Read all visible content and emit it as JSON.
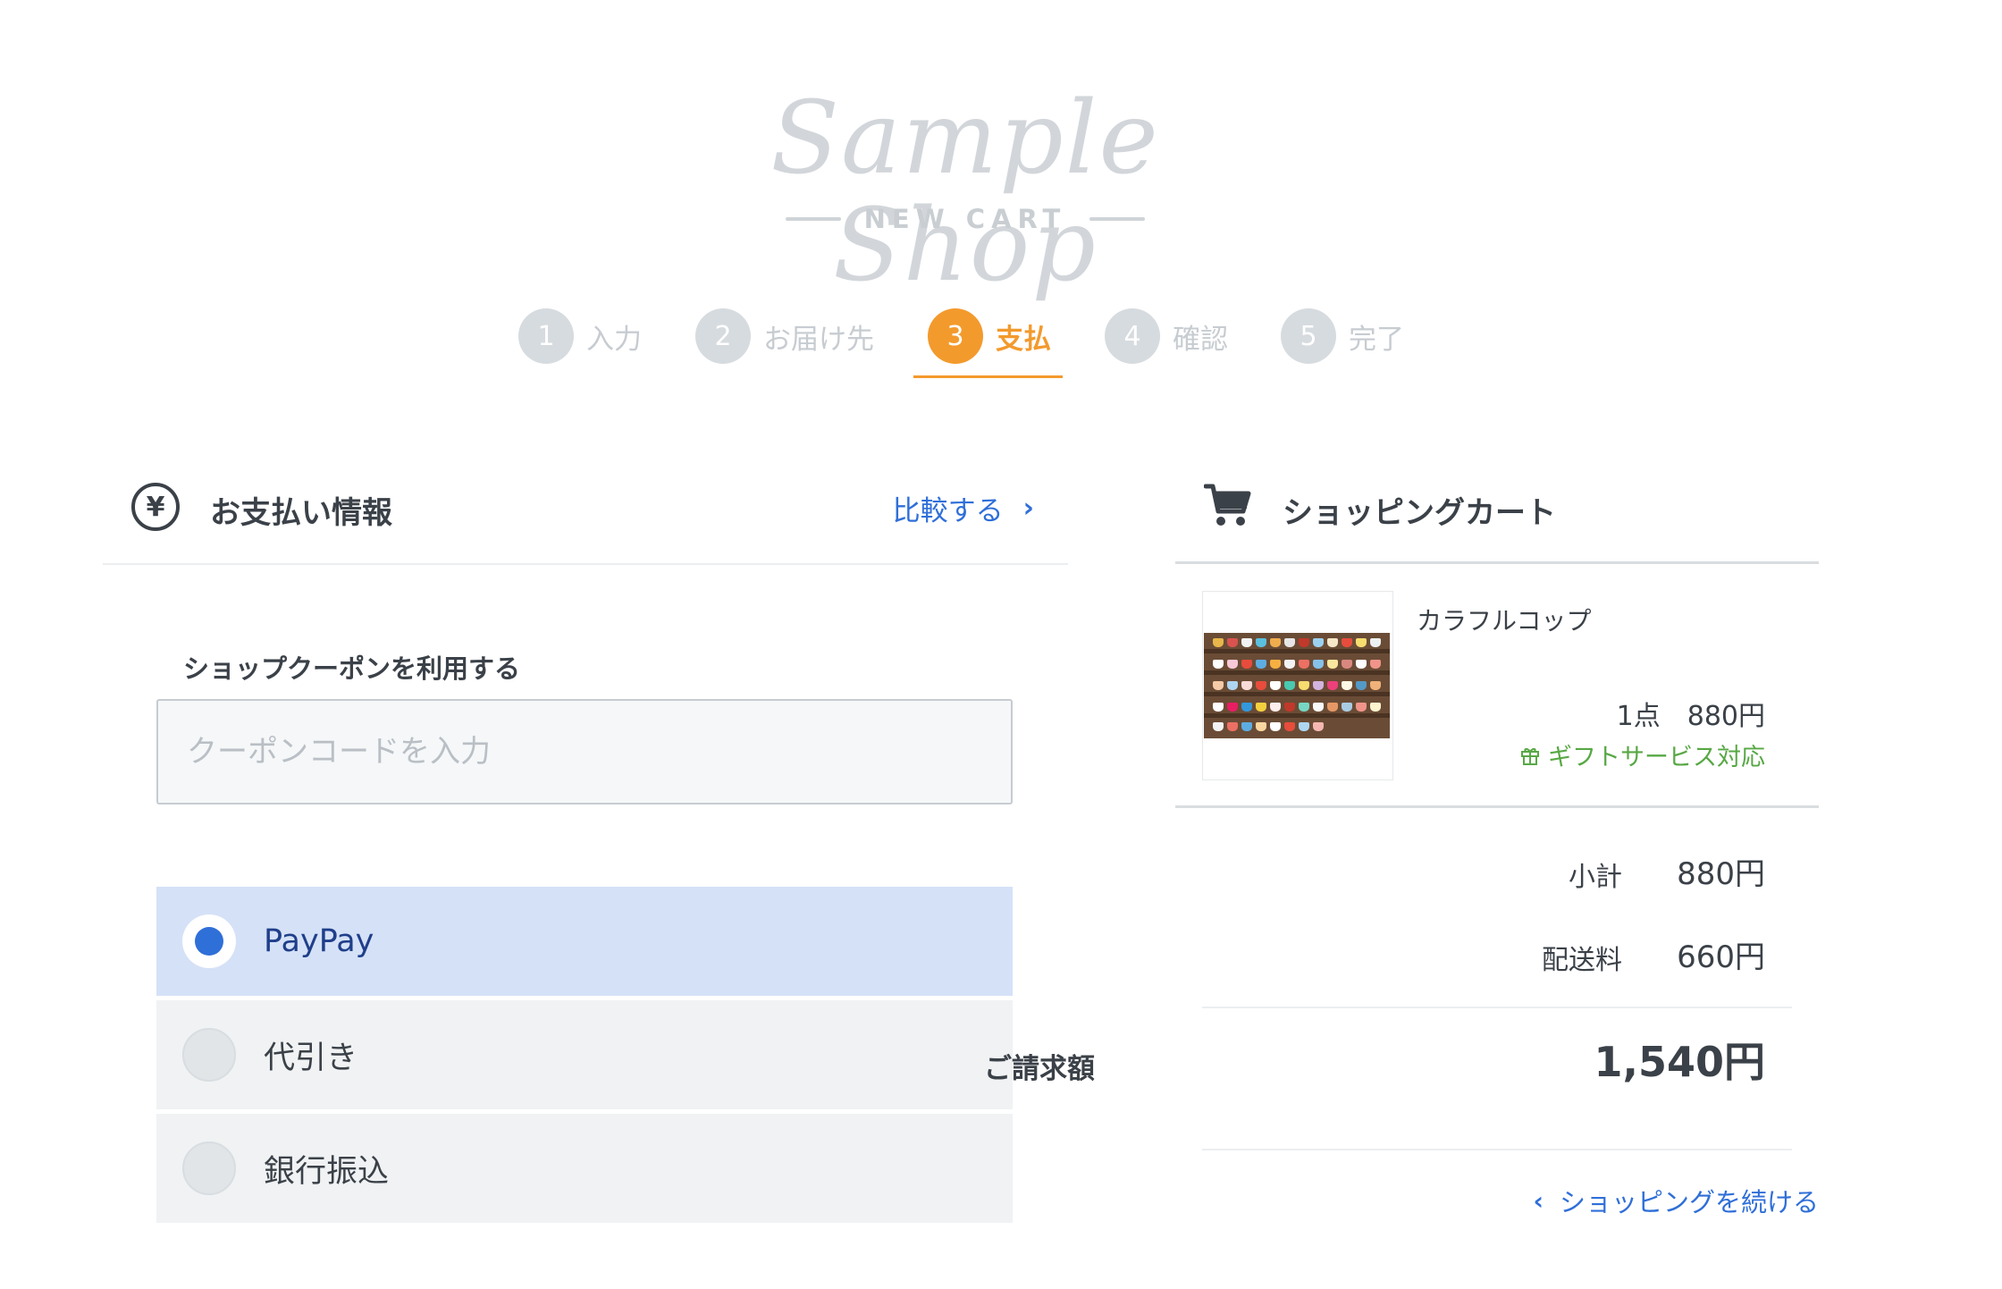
{
  "logo": {
    "script_text": "Sample Shop",
    "subtitle": "NEW CART"
  },
  "steps": [
    {
      "num": "1",
      "label": "入力"
    },
    {
      "num": "2",
      "label": "お届け先"
    },
    {
      "num": "3",
      "label": "支払"
    },
    {
      "num": "4",
      "label": "確認"
    },
    {
      "num": "5",
      "label": "完了"
    }
  ],
  "active_step": 3,
  "payment": {
    "icon": "yen-icon",
    "title": "お支払い情報",
    "compare_label": "比較する",
    "coupon_label": "ショップクーポンを利用する",
    "coupon_placeholder": "クーポンコードを入力",
    "coupon_value": "",
    "options": [
      {
        "label": "PayPay",
        "selected": true
      },
      {
        "label": "代引き",
        "selected": false
      },
      {
        "label": "銀行振込",
        "selected": false
      }
    ]
  },
  "cart": {
    "icon": "cart-icon",
    "title": "ショッピングカート",
    "item": {
      "name": "カラフルコップ",
      "qty_price": "1点　880円",
      "gift": "ギフトサービス対応"
    },
    "subtotal_label": "小計",
    "subtotal_value": "880円",
    "shipping_label": "配送料",
    "shipping_value": "660円",
    "total_label": "ご請求額",
    "total_value": "1,540円",
    "continue_label": "ショッピングを続ける"
  },
  "colors": {
    "accent": "#f39a2d",
    "link": "#2f6fd8",
    "selected_bg": "#d5e1f7",
    "gift": "#58a845"
  }
}
